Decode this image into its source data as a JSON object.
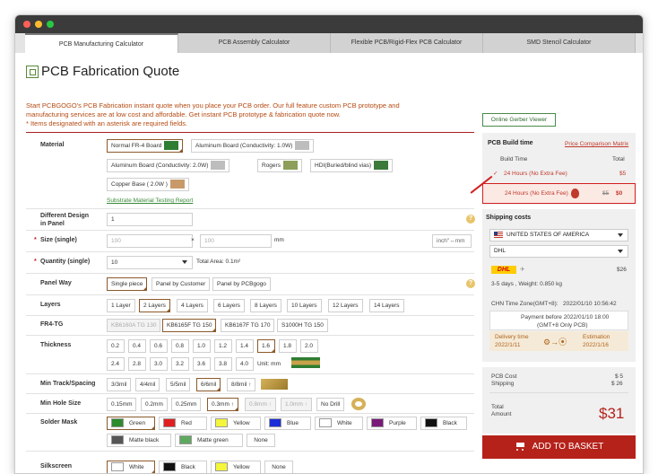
{
  "tabs": [
    "PCB Manufacturing Calculator",
    "PCB Assembly Calculator",
    "Flexible PCB/Rigid-Flex PCB Calculator",
    "SMD Stencil Calculator"
  ],
  "page_title": "PCB Fabrication Quote",
  "intro": {
    "line1": "Start PCBGOGO's PCB Fabrication instant quote when you place your PCB order. Our full feature custom PCB prototype and",
    "line2": "manufacturing services are at low cost and affordable. Get instant PCB prototype & fabrication quote now.",
    "line3": "* Items designated with an asterisk are required fields."
  },
  "online_gerber_viewer": "Online Gerber Viewer",
  "material": {
    "label": "Material",
    "options": [
      "Normal FR-4 Board",
      "Aluminum Board  (Conductivity: 1.0W)",
      "Aluminum Board  (Conductivity: 2.0W)",
      "Rogers",
      "HDI(Buried/blind vias)",
      "Copper Base ( 2.0W )"
    ],
    "link": "Substrate Material Testing Report"
  },
  "design_in_panel": {
    "label_line1": "Different Design",
    "label_line2": "in Panel",
    "value": "1"
  },
  "size": {
    "label": "Size (single)",
    "placeholder_w": "100",
    "placeholder_h": "100",
    "times": "×",
    "unit": "mm",
    "unit_toggle": "inch\"↔mm"
  },
  "quantity": {
    "label": "Quantity (single)",
    "value": "10",
    "total_area": "Total Area: 0.1m²"
  },
  "panel_way": {
    "label": "Panel Way",
    "options": [
      "Single piece",
      "Panel by Customer",
      "Panel by PCBgogo"
    ]
  },
  "layers": {
    "label": "Layers",
    "options": [
      "1 Layer",
      "2 Layers",
      "4 Layers",
      "6 Layers",
      "8 Layers",
      "10 Layers",
      "12 Layers",
      "14 Layers"
    ]
  },
  "fr4_tg": {
    "label": "FR4-TG",
    "options": [
      "KB6160A TG 130",
      "KB6165F TG 150",
      "KB6167F TG 170",
      "S1000H TG 150"
    ]
  },
  "thickness": {
    "label": "Thickness",
    "row1": [
      "0.2",
      "0.4",
      "0.6",
      "0.8",
      "1.0",
      "1.2",
      "1.4",
      "1.6",
      "1.8",
      "2.0"
    ],
    "row2": [
      "2.4",
      "2.8",
      "3.0",
      "3.2",
      "3.6",
      "3.8",
      "4.0"
    ],
    "unit": "Unit: mm"
  },
  "track": {
    "label": "Min Track/Spacing",
    "options": [
      "3/3mil",
      "4/4mil",
      "5/5mil",
      "6/6mil",
      "8/8mil ↑"
    ]
  },
  "hole": {
    "label": "Min Hole Size",
    "options": [
      "0.15mm",
      "0.2mm",
      "0.25mm",
      "0.3mm ↑",
      "0.8mm ↑",
      "1.0mm ↑",
      "No Drill"
    ]
  },
  "solder_mask": {
    "label": "Solder Mask",
    "options": [
      "Green",
      "Red",
      "Yellow",
      "Blue",
      "White",
      "Purple",
      "Black",
      "Matte black",
      "Matte green",
      "None"
    ]
  },
  "silkscreen": {
    "label": "Silkscreen",
    "options": [
      "White",
      "Black",
      "Yellow",
      "None"
    ]
  },
  "colors": {
    "green": "#2e8b2e",
    "red": "#e02020",
    "yellow": "#f5f53a",
    "blue": "#1a2ed8",
    "white": "#ffffff",
    "purple": "#7a1a7a",
    "black": "#111111",
    "matte_black": "#555555",
    "matte_green": "#5fa85f",
    "accent": "#b5221a"
  },
  "build_time": {
    "title": "PCB Build time",
    "compare_link": "Price Comparison Matrix",
    "col_build": "Build Time",
    "col_total": "Total",
    "option1": "24 Hours (No Extra Fee)",
    "option1_price": "$5",
    "option2": "24 Hours (No Extra Fee)",
    "option2_old": "$5",
    "option2_price": "$0"
  },
  "shipping": {
    "title": "Shipping costs",
    "country": "UNITED STATES OF AMERICA",
    "carrier": "DHL",
    "carrier_logo": "DHL",
    "price": "$26",
    "days": "3-5 days ,   Weight: 0.850 kg",
    "timezone_label": "CHN Time Zone(GMT+8):",
    "timezone_value": "2022/01/10 10:56:42",
    "payment_line1": "Payment before 2022/01/10 18:00",
    "payment_line2": "(GMT+8 Only PCB)",
    "delivery_label": "Delivery time",
    "delivery_date": "2022/1/11",
    "estimation_label": "Estimation",
    "estimation_date": "2022/1/16"
  },
  "costs": {
    "pcb_label": "PCB Cost",
    "pcb_value": "$ 5",
    "shipping_label": "Shipping",
    "shipping_value": "$ 26"
  },
  "total": {
    "label_line1": "Total",
    "label_line2": "Amount",
    "value": "$31"
  },
  "add_to_basket": "ADD TO BASKET"
}
